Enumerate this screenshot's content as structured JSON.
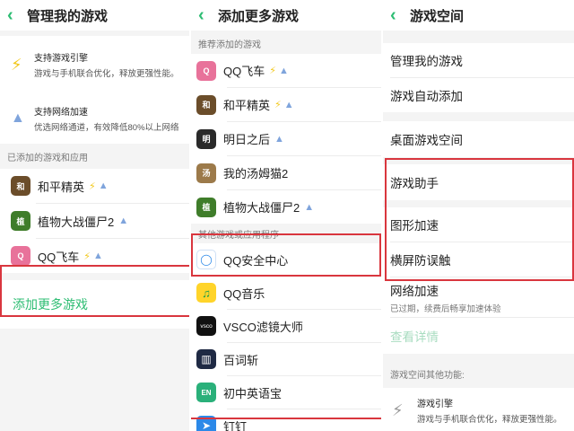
{
  "panel1": {
    "title": "管理我的游戏",
    "features": [
      {
        "title": "支持游戏引擎",
        "desc": "游戏与手机联合优化，释放更强性能。",
        "icon": "bolt-icon"
      },
      {
        "title": "支持网络加速",
        "desc": "优选网络通道，有效降低80%以上网络",
        "icon": "rocket-icon"
      }
    ],
    "added_label": "已添加的游戏和应用",
    "games": [
      {
        "name": "和平精英",
        "icon": "peace-elite-icon",
        "color": "#6b4d2a"
      },
      {
        "name": "植物大战僵尸2",
        "icon": "pvz2-icon",
        "color": "#3f7d2a"
      },
      {
        "name": "QQ飞车",
        "icon": "qq-speed-icon",
        "color": "#e8729a"
      }
    ],
    "add_more": "添加更多游戏"
  },
  "panel2": {
    "title": "添加更多游戏",
    "recommended_label": "推荐添加的游戏",
    "recommended": [
      {
        "name": "QQ飞车",
        "bolt": true,
        "rocket": true,
        "color": "#e8729a"
      },
      {
        "name": "和平精英",
        "bolt": true,
        "rocket": true,
        "color": "#6b4d2a"
      },
      {
        "name": "明日之后",
        "bolt": false,
        "rocket": true,
        "color": "#2a2a2a"
      },
      {
        "name": "我的汤姆猫2",
        "bolt": false,
        "rocket": false,
        "color": "#9c7a4a"
      },
      {
        "name": "植物大战僵尸2",
        "bolt": false,
        "rocket": true,
        "color": "#3f7d2a"
      }
    ],
    "other_label": "其他游戏或应用程序",
    "others": [
      {
        "name": "QQ安全中心",
        "glyph": "◯",
        "color": "#ffffff",
        "fg": "#2c89e8"
      },
      {
        "name": "QQ音乐",
        "glyph": "♫",
        "color": "#ffd42a",
        "fg": "#1a9e4a"
      },
      {
        "name": "VSCO滤镜大师",
        "glyph": "vsco",
        "color": "#111111",
        "fg": "#ffffff"
      },
      {
        "name": "百词斩",
        "glyph": "▥",
        "color": "#1f2a44",
        "fg": "#ffffff"
      },
      {
        "name": "初中英语宝",
        "glyph": "EN",
        "color": "#2ab07a",
        "fg": "#ffffff"
      },
      {
        "name": "钉钉",
        "glyph": "➤",
        "color": "#2c89e8",
        "fg": "#ffffff"
      }
    ]
  },
  "panel3": {
    "title": "游戏空间",
    "items": [
      "管理我的游戏",
      "游戏自动添加",
      "桌面游戏空间",
      "游戏助手",
      "图形加速",
      "横屏防误触"
    ],
    "network_title": "网络加速",
    "network_desc": "已过期，续费后畅享加速体验",
    "view_details": "查看详情",
    "other_label": "游戏空间其他功能:",
    "engine_title": "游戏引擎",
    "engine_desc": "游戏与手机联合优化，释放更强性能。"
  },
  "colors": {
    "accent": "#2ebd73",
    "highlight": "#d9363e",
    "bolt": "#f2c81c",
    "rocket": "#7fa4dc"
  }
}
